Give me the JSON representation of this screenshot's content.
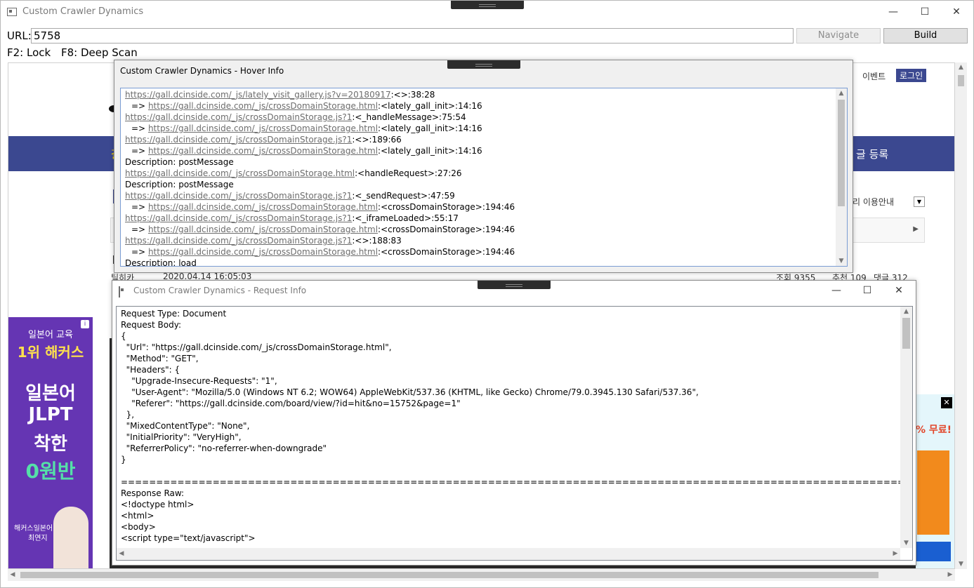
{
  "window": {
    "title": "Custom Crawler Dynamics",
    "minimize": "—",
    "maximize": "☐",
    "close": "✕"
  },
  "toolbar": {
    "url_label": "URL:",
    "url_value": "5758",
    "navigate_label": "Navigate",
    "build_label": "Build",
    "hint_lock": "F2: Lock",
    "hint_deep": "F8: Deep Scan"
  },
  "background_page": {
    "top_links": [
      "이벤트",
      "로그인"
    ],
    "nav_text_left": "갈",
    "nav_text_right": "글 등록",
    "tab_right": "리 이용안내",
    "meta_author": "틸히카",
    "meta_date": "2020.04.14 16:05:03",
    "meta_views": "조회 9355",
    "meta_recommend": "추천 109",
    "meta_comments": "댓글 312",
    "ad_left": {
      "line1": "일본어 교육",
      "line2": "1위 해커스",
      "line3": "일본어",
      "line4": "JLPT",
      "line5": "착한",
      "line6": "0원반",
      "line7": "해커스일본어",
      "line8": "최연지",
      "info": "i"
    },
    "ad_right": {
      "text1": "% 무료!",
      "close": "✕"
    }
  },
  "hover_window": {
    "title": "Custom Crawler Dynamics - Hover Info",
    "lines": [
      {
        "indent": false,
        "link": "https://gall.dcinside.com/_js/lately_visit_gallery.js?v=20180917",
        "rest": ":<>:38:28"
      },
      {
        "indent": true,
        "link": "https://gall.dcinside.com/_js/crossDomainStorage.html",
        "rest": ":<lately_gall_init>:14:16"
      },
      {
        "indent": false,
        "link": "https://gall.dcinside.com/_js/crossDomainStorage.js?1",
        "rest": ":<_handleMessage>:75:54"
      },
      {
        "indent": true,
        "link": "https://gall.dcinside.com/_js/crossDomainStorage.html",
        "rest": ":<lately_gall_init>:14:16"
      },
      {
        "indent": false,
        "link": "https://gall.dcinside.com/_js/crossDomainStorage.js?1",
        "rest": ":<>:189:66"
      },
      {
        "indent": true,
        "link": "https://gall.dcinside.com/_js/crossDomainStorage.html",
        "rest": ":<lately_gall_init>:14:16"
      },
      {
        "indent": false,
        "link": "",
        "rest": "Description: postMessage"
      },
      {
        "indent": false,
        "link": "https://gall.dcinside.com/_js/crossDomainStorage.html",
        "rest": ":<handleRequest>:27:26"
      },
      {
        "indent": false,
        "link": "",
        "rest": "Description: postMessage"
      },
      {
        "indent": false,
        "link": "https://gall.dcinside.com/_js/crossDomainStorage.js?1",
        "rest": ":<_sendRequest>:47:59"
      },
      {
        "indent": true,
        "link": "https://gall.dcinside.com/_js/crossDomainStorage.html",
        "rest": ":<crossDomainStorage>:194:46"
      },
      {
        "indent": false,
        "link": "https://gall.dcinside.com/_js/crossDomainStorage.js?1",
        "rest": ":<_iframeLoaded>:55:17"
      },
      {
        "indent": true,
        "link": "https://gall.dcinside.com/_js/crossDomainStorage.html",
        "rest": ":<crossDomainStorage>:194:46"
      },
      {
        "indent": false,
        "link": "https://gall.dcinside.com/_js/crossDomainStorage.js?1",
        "rest": ":<>:188:83"
      },
      {
        "indent": true,
        "link": "https://gall.dcinside.com/_js/crossDomainStorage.html",
        "rest": ":<crossDomainStorage>:194:46"
      },
      {
        "indent": false,
        "link": "",
        "rest": "Description: load"
      }
    ]
  },
  "request_window": {
    "title": "Custom Crawler Dynamics - Request Info",
    "lines": [
      "Request Type: Document",
      "Request Body:",
      "{",
      "  \"Url\": \"https://gall.dcinside.com/_js/crossDomainStorage.html\",",
      "  \"Method\": \"GET\",",
      "  \"Headers\": {",
      "    \"Upgrade-Insecure-Requests\": \"1\",",
      "    \"User-Agent\": \"Mozilla/5.0 (Windows NT 6.2; WOW64) AppleWebKit/537.36 (KHTML, like Gecko) Chrome/79.0.3945.130 Safari/537.36\",",
      "    \"Referer\": \"https://gall.dcinside.com/board/view/?id=hit&no=15752&page=1\"",
      "  },",
      "  \"MixedContentType\": \"None\",",
      "  \"InitialPriority\": \"VeryHigh\",",
      "  \"ReferrerPolicy\": \"no-referrer-when-downgrade\"",
      "}",
      "",
      "==================================================================================================================================================",
      "Response Raw:",
      "<!doctype html>",
      "<html>",
      "<body>",
      "<script type=\"text/javascript\">"
    ]
  }
}
